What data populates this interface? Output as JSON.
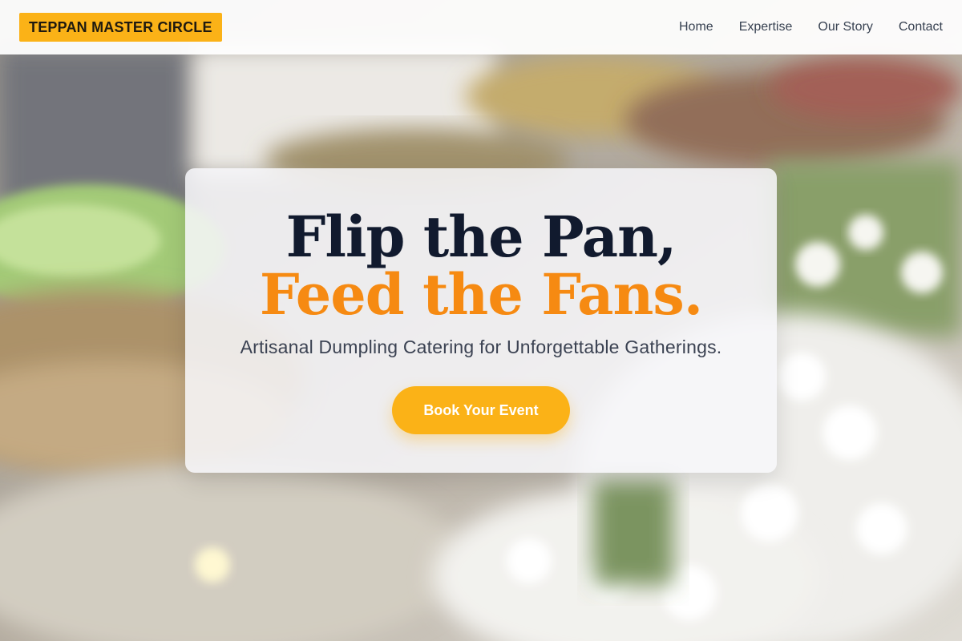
{
  "brand": {
    "name": "TEPPAN MASTER CIRCLE",
    "accent_color": "#fbb217"
  },
  "nav": {
    "items": [
      {
        "label": "Home"
      },
      {
        "label": "Expertise"
      },
      {
        "label": "Our Story"
      },
      {
        "label": "Contact"
      }
    ]
  },
  "hero": {
    "headline_line1": "Flip the Pan,",
    "headline_line2": "Feed the Fans.",
    "headline_line1_color": "#111a2e",
    "headline_line2_color": "#f68a12",
    "subtitle": "Artisanal Dumpling Catering for Unforgettable Gatherings.",
    "cta_label": "Book Your Event",
    "background_image": "blurred-catering-buffet-photo"
  }
}
